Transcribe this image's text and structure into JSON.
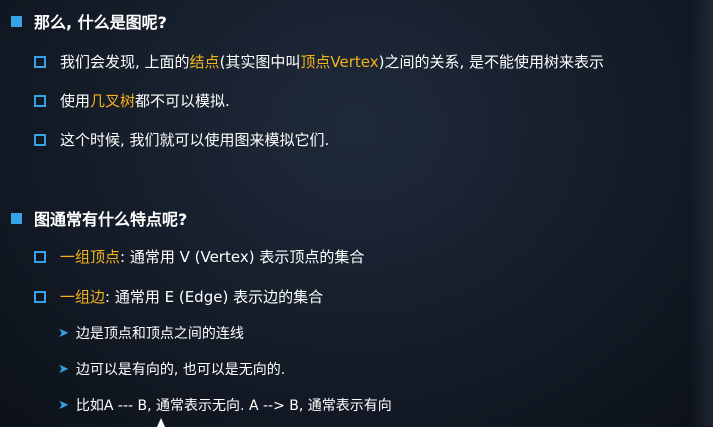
{
  "section1": {
    "heading": "那么, 什么是图呢?",
    "items": [
      {
        "p1": "我们会发现, 上面的",
        "hl1": "结点",
        "p2": "(其实图中叫",
        "hl2": "顶点Vertex",
        "p3": ")之间的关系, 是不能使用树来表示"
      },
      {
        "p1": "使用",
        "hl1": "几叉树",
        "p2": "都不可以模拟."
      },
      {
        "p1": "这个时候, 我们就可以使用图来模拟它们."
      }
    ]
  },
  "section2": {
    "heading": "图通常有什么特点呢?",
    "items": [
      {
        "hl": "一组顶点",
        "text": ": 通常用 V (Vertex) 表示顶点的集合"
      },
      {
        "hl": "一组边",
        "text": ": 通常用 E (Edge) 表示边的集合"
      }
    ],
    "subitems": [
      "边是顶点和顶点之间的连线",
      "边可以是有向的, 也可以是无向的.",
      "比如A --- B, 通常表示无向. A --> B, 通常表示有向"
    ]
  },
  "colors": {
    "bullet": "#35a3e6",
    "highlight": "#f5b21b",
    "text": "#ffffff",
    "background": "#141c28"
  }
}
